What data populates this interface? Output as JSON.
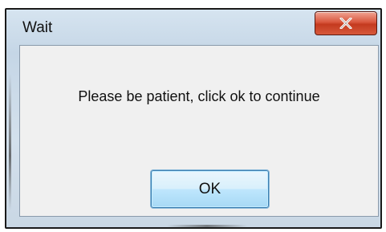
{
  "window": {
    "title": "Wait",
    "close_icon": "close-x-icon"
  },
  "dialog": {
    "message": "Please be patient, click ok to continue",
    "ok_label": "OK"
  },
  "colors": {
    "close_button": "#d6503a",
    "ok_button_border": "#3c7fb1",
    "client_background": "#f0f0f0",
    "frame_background": "#cfdceb"
  }
}
